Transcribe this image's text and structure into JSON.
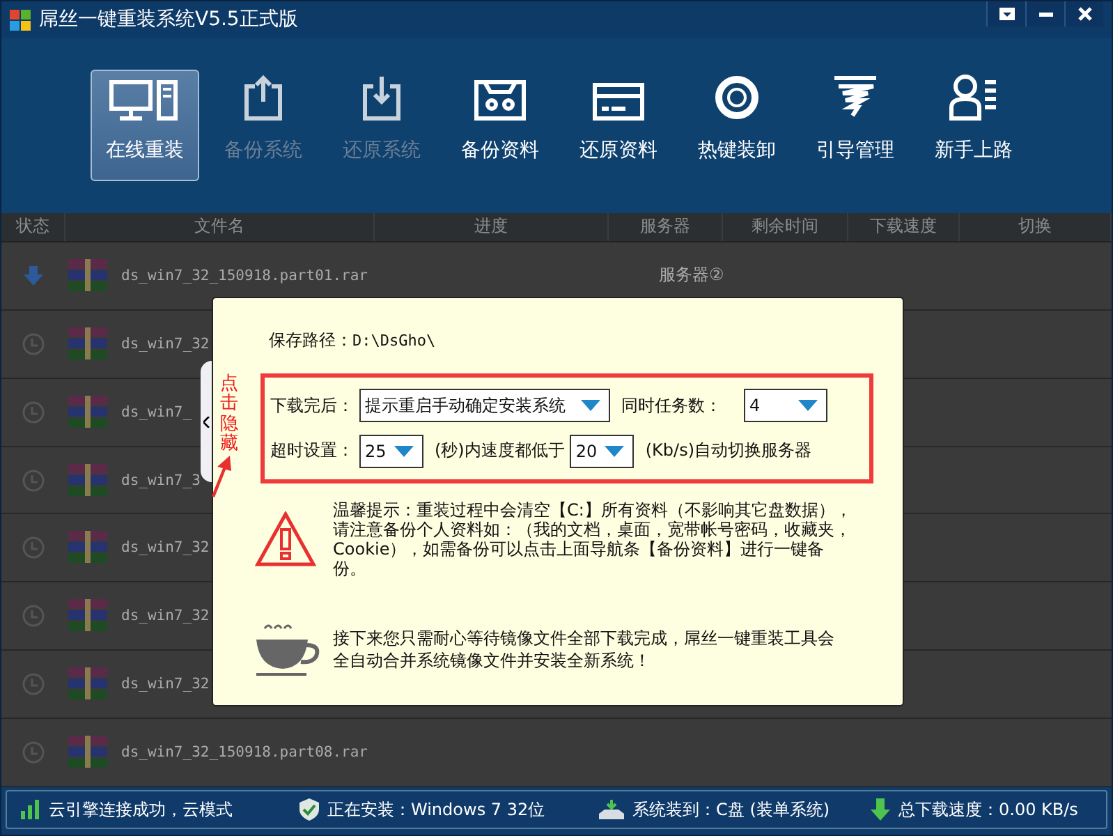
{
  "window": {
    "title": "屌丝一键重装系统V5.5正式版"
  },
  "toolbar": [
    {
      "label": "在线重装",
      "kind": "computer",
      "selected": true,
      "disabled": false
    },
    {
      "label": "备份系统",
      "kind": "upload",
      "selected": false,
      "disabled": true
    },
    {
      "label": "还原系统",
      "kind": "download",
      "selected": false,
      "disabled": true
    },
    {
      "label": "备份资料",
      "kind": "tape",
      "selected": false,
      "disabled": false
    },
    {
      "label": "还原资料",
      "kind": "card",
      "selected": false,
      "disabled": false
    },
    {
      "label": "热键装卸",
      "kind": "ring",
      "selected": false,
      "disabled": false
    },
    {
      "label": "引导管理",
      "kind": "tornado",
      "selected": false,
      "disabled": false
    },
    {
      "label": "新手上路",
      "kind": "user",
      "selected": false,
      "disabled": false
    }
  ],
  "table": {
    "columns": [
      "状态",
      "文件名",
      "进度",
      "服务器",
      "剩余时间",
      "下载速度",
      "切换"
    ],
    "rows": [
      {
        "kind": "downloading",
        "file": "ds_win7_32_150918.part01.rar",
        "server": "服务器②"
      },
      {
        "kind": "waiting",
        "file": "ds_win7_32"
      },
      {
        "kind": "waiting",
        "file": "ds_win7_"
      },
      {
        "kind": "waiting",
        "file": "ds_win7_3"
      },
      {
        "kind": "waiting",
        "file": "ds_win7_32"
      },
      {
        "kind": "waiting",
        "file": "ds_win7_32"
      },
      {
        "kind": "waiting",
        "file": "ds_win7_32"
      },
      {
        "kind": "waiting",
        "file": "ds_win7_32_150918.part08.rar"
      }
    ]
  },
  "panel": {
    "hide_tab": "点击隐藏",
    "save_path_label": "保存路径：",
    "save_path": "D:\\DsGho\\",
    "after_download_label": "下载完后：",
    "after_download": "提示重启手动确定安装系统",
    "tasks_label": "同时任务数：",
    "tasks": "4",
    "timeout_label": "超时设置：",
    "timeout": "25",
    "seconds_label": "(秒)内速度都低于",
    "speed": "20",
    "switch_label": "(Kb/s)自动切换服务器",
    "warning": "温馨提示：重装过程中会清空【C:】所有资料（不影响其它盘数据），请注意备份个人资料如：（我的文档，桌面，宽带帐号密码，收藏夹，Cookie），如需备份可以点击上面导航条【备份资料】进行一键备份。",
    "note": "接下来您只需耐心等待镜像文件全部下载完成，屌丝一键重装工具会全自动合并系统镜像文件并安装全新系统！"
  },
  "status_bar": [
    {
      "kind": "signal",
      "text": "云引擎连接成功，云模式"
    },
    {
      "kind": "shield",
      "text": "正在安装：Windows 7 32位"
    },
    {
      "kind": "disk",
      "text": "系统装到：C盘 (装单系统)"
    },
    {
      "kind": "speed",
      "text": "总下载速度：0.00 KB/s"
    }
  ]
}
